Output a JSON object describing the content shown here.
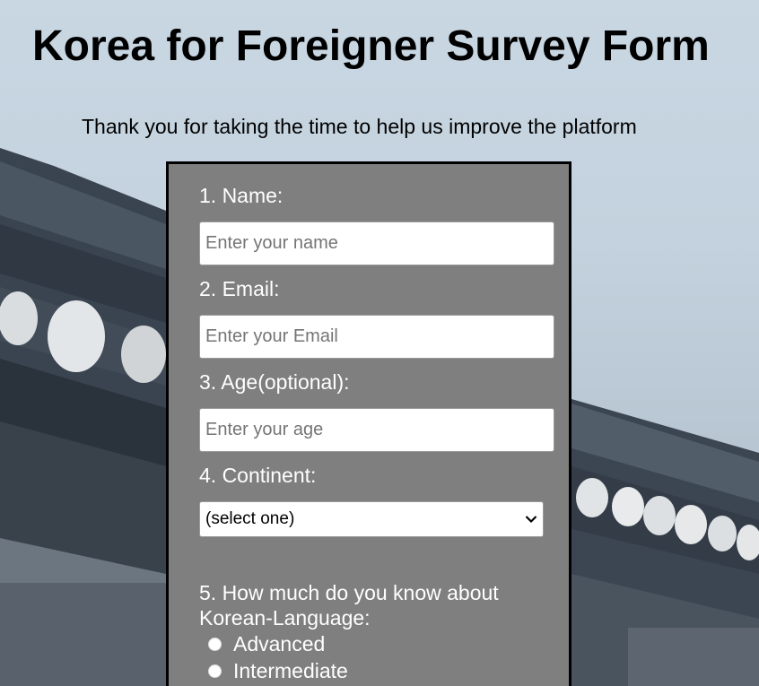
{
  "header": {
    "title": "Korea for Foreigner Survey Form",
    "subtitle": "Thank you for taking the time to help us improve the platform"
  },
  "form": {
    "name": {
      "label": "1. Name:",
      "placeholder": "Enter your name",
      "value": ""
    },
    "email": {
      "label": "2. Email:",
      "placeholder": "Enter your Email",
      "value": ""
    },
    "age": {
      "label": "3. Age(optional):",
      "placeholder": "Enter your age",
      "value": ""
    },
    "continent": {
      "label": "4. Continent:",
      "selected": "(select one)"
    },
    "korean_level": {
      "label_line1": "5. How much do you know about",
      "label_line2": "Korean-Language:",
      "options": [
        {
          "label": "Advanced",
          "checked": false
        },
        {
          "label": "Intermediate",
          "checked": false
        }
      ]
    }
  },
  "icons": {
    "select_arrow": "chevron-down-icon",
    "radio": "radio-button-icon"
  },
  "colors": {
    "panel_background": "#7f7f7f",
    "panel_border": "#000000",
    "label_text": "#ffffff",
    "title_text": "#000000"
  }
}
